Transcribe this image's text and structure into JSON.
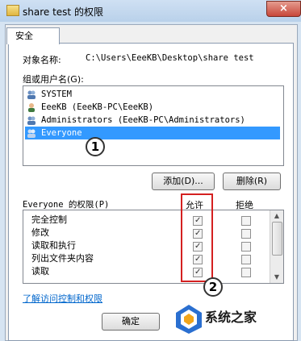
{
  "window": {
    "title": "share test 的权限",
    "close_symbol": "×"
  },
  "tab": {
    "label": "安全"
  },
  "object_name": {
    "label": "对象名称:",
    "value": "C:\\Users\\EeeKB\\Desktop\\share test"
  },
  "groups": {
    "label": "组或用户名(G):",
    "items": [
      {
        "label": "SYSTEM"
      },
      {
        "label": "EeeKB (EeeKB-PC\\EeeKB)"
      },
      {
        "label": "Administrators (EeeKB-PC\\Administrators)"
      },
      {
        "label": "Everyone"
      }
    ]
  },
  "buttons": {
    "add": "添加(D)...",
    "remove": "删除(R)",
    "ok": "确定"
  },
  "permissions": {
    "label": "Everyone 的权限(P)",
    "allow_header": "允许",
    "deny_header": "拒绝",
    "rows": [
      {
        "name": "完全控制",
        "allow": true,
        "deny": false
      },
      {
        "name": "修改",
        "allow": true,
        "deny": false
      },
      {
        "name": "读取和执行",
        "allow": true,
        "deny": false
      },
      {
        "name": "列出文件夹内容",
        "allow": true,
        "deny": false
      },
      {
        "name": "读取",
        "allow": true,
        "deny": false
      }
    ]
  },
  "link": {
    "label": "了解访问控制和权限"
  },
  "markers": {
    "one": "1",
    "two": "2"
  },
  "watermark": {
    "brand": "系统之家"
  },
  "colors": {
    "selection": "#3399ff",
    "highlight_box": "#d42020"
  }
}
